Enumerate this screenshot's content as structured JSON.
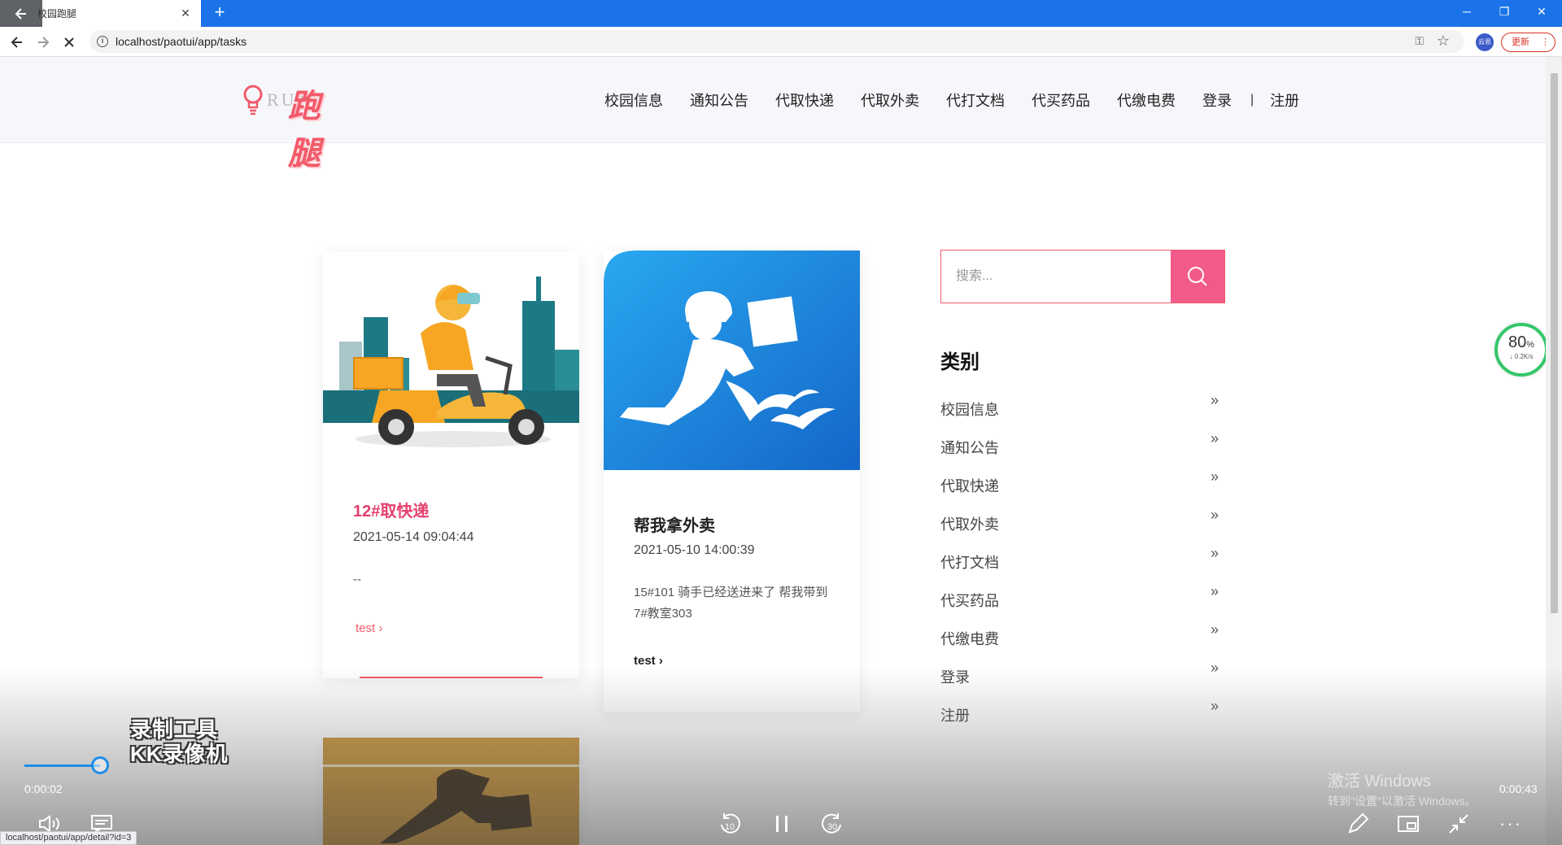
{
  "browser": {
    "tab_title": "校园跑腿",
    "url": "localhost/paotui/app/tasks",
    "profile_label": "云思",
    "update_label": "更新"
  },
  "site": {
    "logo_text_en": "RUN",
    "logo_text_cn": "跑腿",
    "nav": [
      "校园信息",
      "通知公告",
      "代取快递",
      "代取外卖",
      "代打文档",
      "代买药品",
      "代缴电费",
      "登录"
    ],
    "nav_separator": "|",
    "nav_register": "注册"
  },
  "cards": [
    {
      "title": "12#取快递",
      "date": "2021-05-14 09:04:44",
      "description": "--",
      "link": "test",
      "title_color": "#e8406e",
      "link_color": "#f25a6a"
    },
    {
      "title": "帮我拿外卖",
      "date": "2021-05-10 14:00:39",
      "description": "15#101 骑手已经送进来了 帮我带到7#教室303",
      "link": "test",
      "title_color": "#222222",
      "link_color": "#222222"
    }
  ],
  "sidebar": {
    "search_placeholder": "搜索...",
    "category_heading": "类别",
    "categories": [
      "校园信息",
      "通知公告",
      "代取快递",
      "代取外卖",
      "代打文档",
      "代买药品",
      "代缴电费",
      "登录",
      "注册"
    ]
  },
  "speed_widget": {
    "percent": "80",
    "percent_unit": "%",
    "rate": "↓ 0.2K/s"
  },
  "video_player": {
    "current_time": "0:00:02",
    "total_time": "0:00:43",
    "progress_fraction": 0.05,
    "watermark_line1": "录制工具",
    "watermark_line2": "KK录像机",
    "rewind_label": "10",
    "forward_label": "30"
  },
  "windows_activation": {
    "line1": "激活 Windows",
    "line2": "转到\"设置\"以激活 Windows。"
  },
  "status_bar_url": "localhost/paotui/app/detail?id=3",
  "colors": {
    "brand": "#f25a6a",
    "search_button": "#f25a8a",
    "chrome_blue": "#1a73e8",
    "progress": "#1f8de8"
  }
}
